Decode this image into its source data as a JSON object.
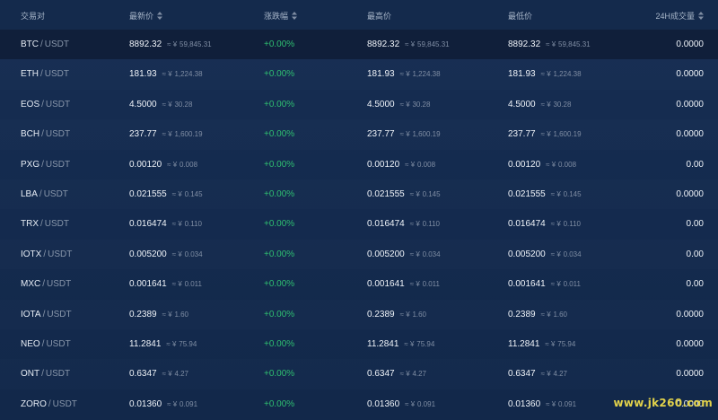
{
  "header": {
    "pair": "交易对",
    "last": "最新价",
    "change": "涨跌幅",
    "high": "最高价",
    "low": "最低价",
    "volume": "24H成交量"
  },
  "separator": "/",
  "approx_symbol": "≈ ¥",
  "rows": [
    {
      "base": "BTC",
      "quote": "USDT",
      "last": "8892.32",
      "last_cny": "59,845.31",
      "change": "+0.00%",
      "high": "8892.32",
      "high_cny": "59,845.31",
      "low": "8892.32",
      "low_cny": "59,845.31",
      "volume": "0.0000"
    },
    {
      "base": "ETH",
      "quote": "USDT",
      "last": "181.93",
      "last_cny": "1,224.38",
      "change": "+0.00%",
      "high": "181.93",
      "high_cny": "1,224.38",
      "low": "181.93",
      "low_cny": "1,224.38",
      "volume": "0.0000"
    },
    {
      "base": "EOS",
      "quote": "USDT",
      "last": "4.5000",
      "last_cny": "30.28",
      "change": "+0.00%",
      "high": "4.5000",
      "high_cny": "30.28",
      "low": "4.5000",
      "low_cny": "30.28",
      "volume": "0.0000"
    },
    {
      "base": "BCH",
      "quote": "USDT",
      "last": "237.77",
      "last_cny": "1,600.19",
      "change": "+0.00%",
      "high": "237.77",
      "high_cny": "1,600.19",
      "low": "237.77",
      "low_cny": "1,600.19",
      "volume": "0.0000"
    },
    {
      "base": "PXG",
      "quote": "USDT",
      "last": "0.00120",
      "last_cny": "0.008",
      "change": "+0.00%",
      "high": "0.00120",
      "high_cny": "0.008",
      "low": "0.00120",
      "low_cny": "0.008",
      "volume": "0.00"
    },
    {
      "base": "LBA",
      "quote": "USDT",
      "last": "0.021555",
      "last_cny": "0.145",
      "change": "+0.00%",
      "high": "0.021555",
      "high_cny": "0.145",
      "low": "0.021555",
      "low_cny": "0.145",
      "volume": "0.0000"
    },
    {
      "base": "TRX",
      "quote": "USDT",
      "last": "0.016474",
      "last_cny": "0.110",
      "change": "+0.00%",
      "high": "0.016474",
      "high_cny": "0.110",
      "low": "0.016474",
      "low_cny": "0.110",
      "volume": "0.00"
    },
    {
      "base": "IOTX",
      "quote": "USDT",
      "last": "0.005200",
      "last_cny": "0.034",
      "change": "+0.00%",
      "high": "0.005200",
      "high_cny": "0.034",
      "low": "0.005200",
      "low_cny": "0.034",
      "volume": "0.00"
    },
    {
      "base": "MXC",
      "quote": "USDT",
      "last": "0.001641",
      "last_cny": "0.011",
      "change": "+0.00%",
      "high": "0.001641",
      "high_cny": "0.011",
      "low": "0.001641",
      "low_cny": "0.011",
      "volume": "0.00"
    },
    {
      "base": "IOTA",
      "quote": "USDT",
      "last": "0.2389",
      "last_cny": "1.60",
      "change": "+0.00%",
      "high": "0.2389",
      "high_cny": "1.60",
      "low": "0.2389",
      "low_cny": "1.60",
      "volume": "0.0000"
    },
    {
      "base": "NEO",
      "quote": "USDT",
      "last": "11.2841",
      "last_cny": "75.94",
      "change": "+0.00%",
      "high": "11.2841",
      "high_cny": "75.94",
      "low": "11.2841",
      "low_cny": "75.94",
      "volume": "0.0000"
    },
    {
      "base": "ONT",
      "quote": "USDT",
      "last": "0.6347",
      "last_cny": "4.27",
      "change": "+0.00%",
      "high": "0.6347",
      "high_cny": "4.27",
      "low": "0.6347",
      "low_cny": "4.27",
      "volume": "0.0000"
    },
    {
      "base": "ZORO",
      "quote": "USDT",
      "last": "0.01360",
      "last_cny": "0.091",
      "change": "+0.00%",
      "high": "0.01360",
      "high_cny": "0.091",
      "low": "0.01360",
      "low_cny": "0.091",
      "volume": "0.0000"
    }
  ],
  "watermark": {
    "main": "www.jk260.com",
    "tld": ".com"
  },
  "colors": {
    "background": "#13294a",
    "header_bg": "#142a4c",
    "positive": "#2fbf71",
    "muted": "#7f8da3",
    "watermark": "#e2d24a"
  }
}
